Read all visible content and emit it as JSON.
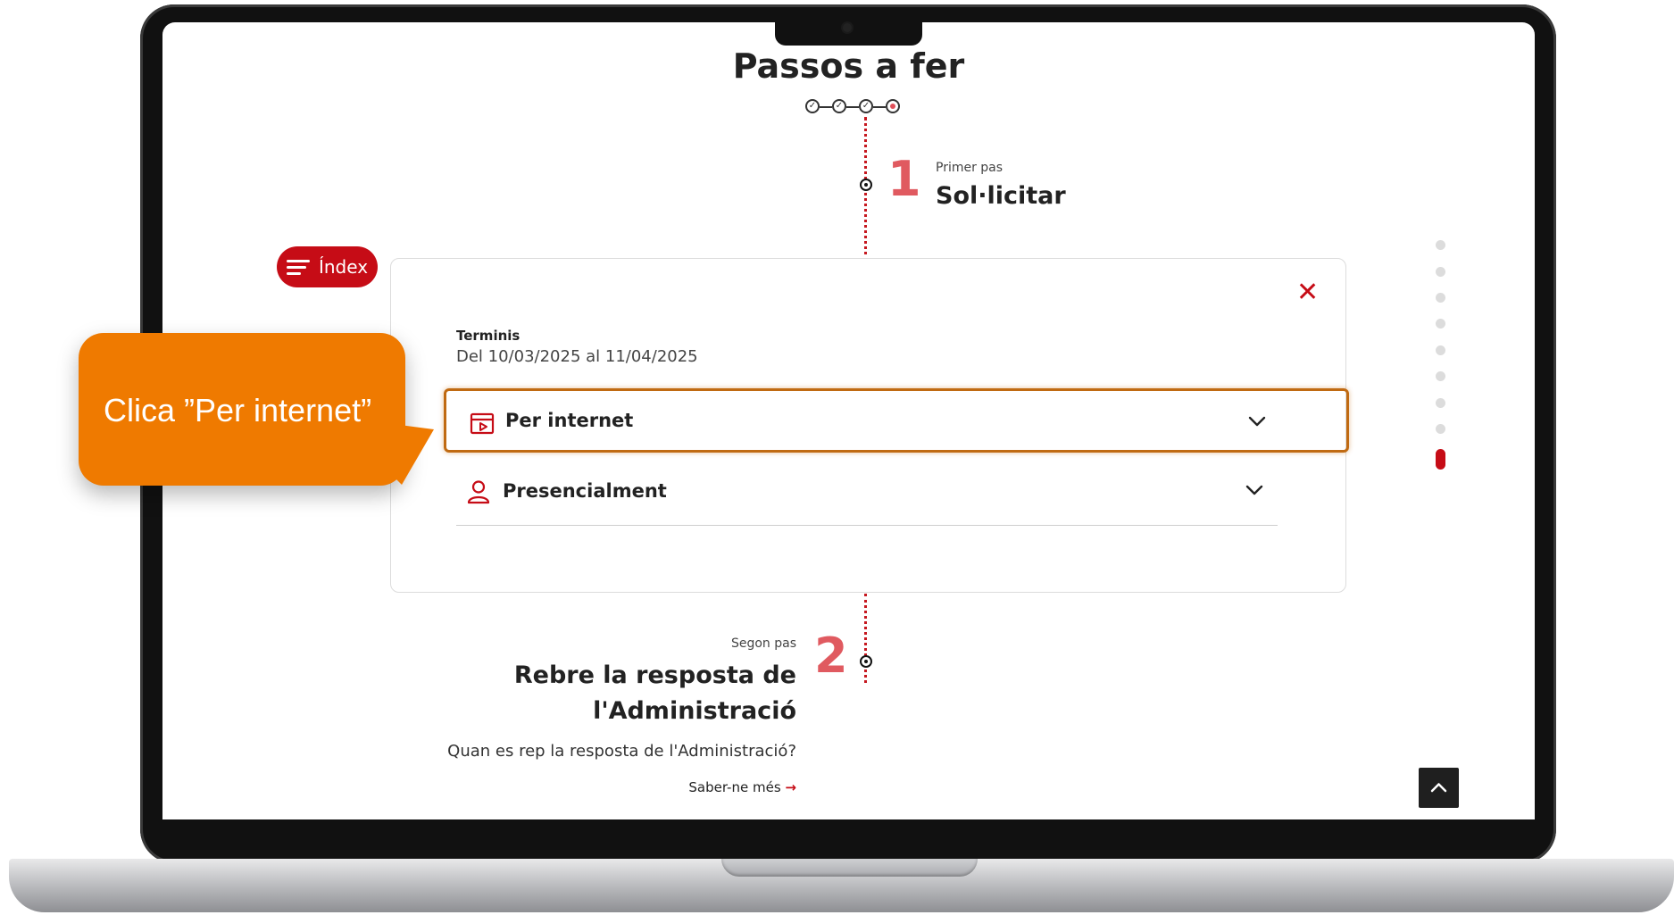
{
  "page": {
    "title": "Passos a fer"
  },
  "progress_steps": [
    {
      "state": "done",
      "glyph": "✓"
    },
    {
      "state": "done",
      "glyph": "✓"
    },
    {
      "state": "done",
      "glyph": "✓"
    },
    {
      "state": "current",
      "glyph": ""
    }
  ],
  "step1": {
    "number": "1",
    "small": "Primer pas",
    "title": "Sol·licitar"
  },
  "index_button": {
    "label": "Índex"
  },
  "panel": {
    "close_glyph": "✕",
    "terminis_label": "Terminis",
    "terminis_value": "Del 10/03/2025 al 11/04/2025",
    "options": [
      {
        "label": "Per internet",
        "icon": "browser-window-icon"
      },
      {
        "label": "Presencialment",
        "icon": "person-icon"
      }
    ]
  },
  "step2": {
    "number": "2",
    "small": "Segon pas",
    "title_line1": "Rebre la resposta de",
    "title_line2": "l'Administració",
    "question": "Quan es rep la resposta de l'Administració?",
    "link": "Saber-ne més",
    "link_arrow": "→"
  },
  "section_nav": {
    "total": 9,
    "active_index": 8
  },
  "callout": {
    "text": "Clica ”Per internet”"
  },
  "colors": {
    "brand_red": "#c60c16",
    "step_number": "#e05a60",
    "callout_orange": "#ef7a00",
    "highlight_border": "#c06a12"
  }
}
